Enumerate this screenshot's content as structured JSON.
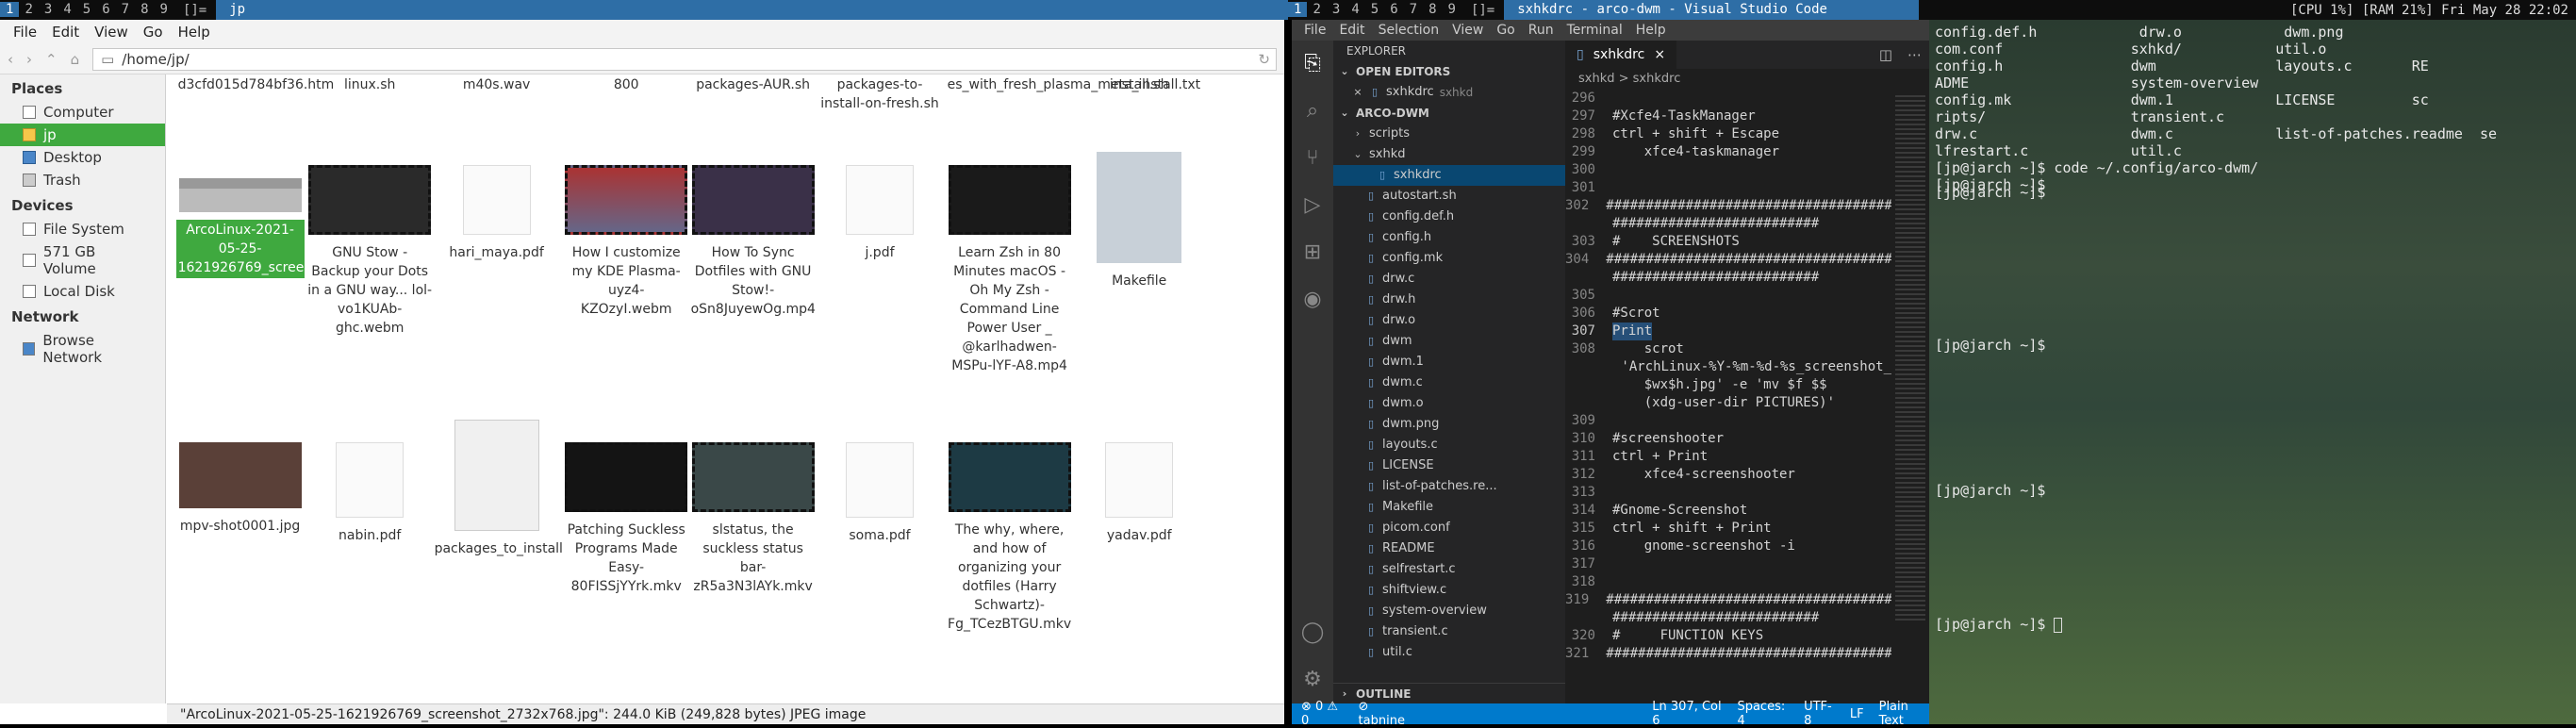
{
  "left_bar": {
    "tags": [
      "1",
      "2",
      "3",
      "4",
      "5",
      "6",
      "7",
      "8",
      "9"
    ],
    "layout": "[]=",
    "title": "jp"
  },
  "right_bar": {
    "tags": [
      "1",
      "2",
      "3",
      "4",
      "5",
      "6",
      "7",
      "8",
      "9"
    ],
    "layout": "[]=",
    "title": "sxhkdrc - arco-dwm - Visual Studio Code",
    "status": "[CPU 1%] [RAM 21%] Fri May 28 22:02"
  },
  "fm": {
    "menu": [
      "File",
      "Edit",
      "View",
      "Go",
      "Help"
    ],
    "path": "/home/jp/",
    "places_header": "Places",
    "places": [
      "Computer",
      "jp",
      "Desktop",
      "Trash"
    ],
    "devices_header": "Devices",
    "devices": [
      "File System",
      "571 GB Volume",
      "Local Disk"
    ],
    "network_header": "Network",
    "network": [
      "Browse Network"
    ],
    "top_row": [
      "d3cfd015d784bf36.htm",
      "linux.sh",
      "m40s.wav",
      "800",
      "packages-AUR.sh",
      "packages-to-install-on-fresh.sh",
      "es_with_fresh_plasma_meta_install.txt",
      "install.sh"
    ],
    "row1": [
      "ArcoLinux-2021-05-25-1621926769_screenshot_2732x768.jpg",
      "GNU Stow - Backup your Dots in a GNU way... lol-vo1KUAb-ghc.webm",
      "hari_maya.pdf",
      "How I customize my KDE Plasma-uyz4-KZOzyI.webm",
      "How To Sync Dotfiles with GNU Stow!-oSn8JuyewOg.mp4",
      "j.pdf",
      "Learn Zsh in 80 Minutes macOS - Oh My Zsh - Command Line Power User _ @karlhadwen-MSPu-lYF-A8.mp4",
      "Makefile"
    ],
    "row2": [
      "mpv-shot0001.jpg",
      "nabin.pdf",
      "packages_to_install",
      "Patching Suckless Programs Made Easy-80FISSjYYrk.mkv",
      "slstatus, the suckless status bar-zR5a3N3lAYk.mkv",
      "soma.pdf",
      "The why, where, and how of organizing your dotfiles (Harry Schwartz)-Fg_TCezBTGU.mkv",
      "yadav.pdf"
    ],
    "status": "\"ArcoLinux-2021-05-25-1621926769_screenshot_2732x768.jpg\": 244.0 KiB (249,828 bytes) JPEG image"
  },
  "vs": {
    "menu": [
      "File",
      "Edit",
      "Selection",
      "View",
      "Go",
      "Run",
      "Terminal",
      "Help"
    ],
    "explorer": "EXPLORER",
    "open_editors": "OPEN EDITORS",
    "open_file": "sxhkdrc",
    "open_dir": "sxhkd",
    "project": "ARCO-DWM",
    "tree": [
      "scripts",
      "sxhkd",
      "sxhkdrc",
      "autostart.sh",
      "config.def.h",
      "config.h",
      "config.mk",
      "drw.c",
      "drw.h",
      "drw.o",
      "dwm",
      "dwm.1",
      "dwm.c",
      "dwm.o",
      "dwm.png",
      "layouts.c",
      "LICENSE",
      "list-of-patches.re...",
      "Makefile",
      "picom.conf",
      "README",
      "selfrestart.c",
      "shiftview.c",
      "system-overview",
      "transient.c",
      "util.c"
    ],
    "outline": "OUTLINE",
    "tab": "sxhkdrc",
    "breadcrumb": "sxhkd  >  sxhkdrc",
    "code": [
      [
        "296",
        ""
      ],
      [
        "297",
        "#Xcfe4-TaskManager"
      ],
      [
        "298",
        "ctrl + shift + Escape"
      ],
      [
        "299",
        "    xfce4-taskmanager"
      ],
      [
        "300",
        ""
      ],
      [
        "301",
        ""
      ],
      [
        "302",
        "###############################################################"
      ],
      [
        "",
        "##########################"
      ],
      [
        "303",
        "#    SCREENSHOTS"
      ],
      [
        "304",
        "###############################################################"
      ],
      [
        "",
        "##########################"
      ],
      [
        "305",
        ""
      ],
      [
        "306",
        "#Scrot"
      ],
      [
        "307",
        "Print"
      ],
      [
        "308",
        "    scrot"
      ],
      [
        "",
        "    'ArchLinux-%Y-%m-%d-%s_screenshot_"
      ],
      [
        "",
        "    $wx$h.jpg' -e 'mv $f $$"
      ],
      [
        "",
        "    (xdg-user-dir PICTURES)'"
      ],
      [
        "309",
        ""
      ],
      [
        "310",
        "#screenshooter"
      ],
      [
        "311",
        "ctrl + Print"
      ],
      [
        "312",
        "    xfce4-screenshooter"
      ],
      [
        "313",
        ""
      ],
      [
        "314",
        "#Gnome-Screenshot"
      ],
      [
        "315",
        "ctrl + shift + Print"
      ],
      [
        "316",
        "    gnome-screenshot -i"
      ],
      [
        "317",
        ""
      ],
      [
        "318",
        ""
      ],
      [
        "319",
        "###############################################################"
      ],
      [
        "",
        "##########################"
      ],
      [
        "320",
        "#     FUNCTION KEYS"
      ],
      [
        "321",
        "###############################################################"
      ]
    ],
    "status": [
      "⊗ 0 ⚠ 0",
      "⊘ tabnine",
      "Ln 307, Col 6",
      "Spaces: 4",
      "UTF-8",
      "LF",
      "Plain Text"
    ]
  },
  "term": {
    "lines": [
      "config.def.h            drw.o            dwm.png          ",
      "com.conf               sxhkd/           util.o            ",
      "config.h               dwm              layouts.c       RE",
      "ADME                   system-overview                    ",
      "config.mk              dwm.1            LICENSE         sc",
      "ripts/                 transient.c                        ",
      "drw.c                  dwm.c            list-of-patches.readme  se",
      "lfrestart.c            util.c                             ",
      "[jp@jarch ~]$ code ~/.config/arco-dwm/",
      "[jp@jarch ~]$ "
    ],
    "prompt": "[jp@jarch ~]$ "
  }
}
